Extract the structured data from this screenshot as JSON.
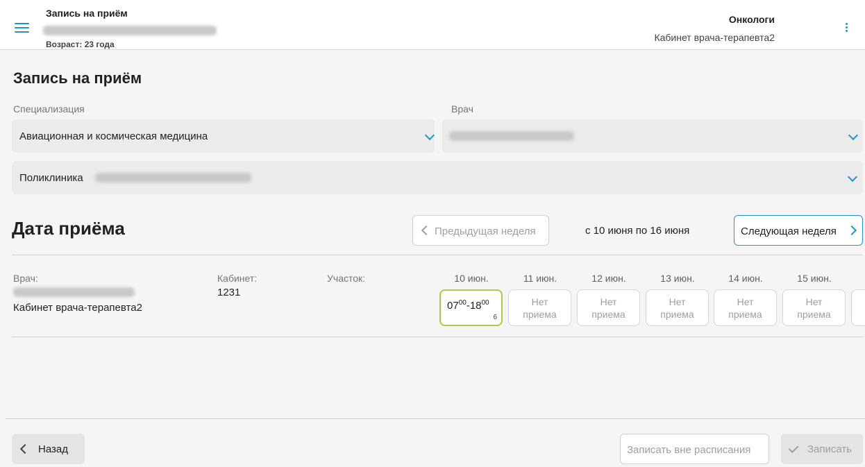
{
  "header": {
    "title": "Запись на приём",
    "age": "Возраст: 23 года",
    "org": "Онкологи",
    "room": "Кабинет врача-терапевта2"
  },
  "form": {
    "title": "Запись на приём",
    "specialization_label": "Специализация",
    "specialization_value": "Авиационная и космическая медицина",
    "doctor_label": "Врач",
    "clinic_value": "Поликлиника"
  },
  "dates": {
    "title": "Дата приёма",
    "prev_week": "Предыдущая неделя",
    "next_week": "Следующая неделя",
    "range": "с 10 июня по 16 июня"
  },
  "table": {
    "headers": {
      "doctor": "Врач:",
      "room": "Кабинет:",
      "area": "Участок:"
    },
    "room_number": "1231",
    "room_name": "Кабинет врача-терапевта2",
    "days": [
      "10 июн.",
      "11 июн.",
      "12 июн.",
      "13 июн.",
      "14 июн.",
      "15 июн."
    ],
    "slot_active": {
      "start_h": "07",
      "start_m": "00",
      "end_h": "18",
      "end_m": "00",
      "count": "6"
    },
    "no_slot_line1": "Нет",
    "no_slot_line2": "приема"
  },
  "footer": {
    "back": "Назад",
    "outside": "Записать вне расписания",
    "book": "Записать"
  },
  "colors": {
    "accent": "#2196c9",
    "active_slot": "#a6cf3d"
  },
  "icons": [
    "menu-icon",
    "more-vert-icon",
    "chevron-down-icon",
    "chevron-left-icon",
    "chevron-right-icon",
    "check-icon"
  ]
}
